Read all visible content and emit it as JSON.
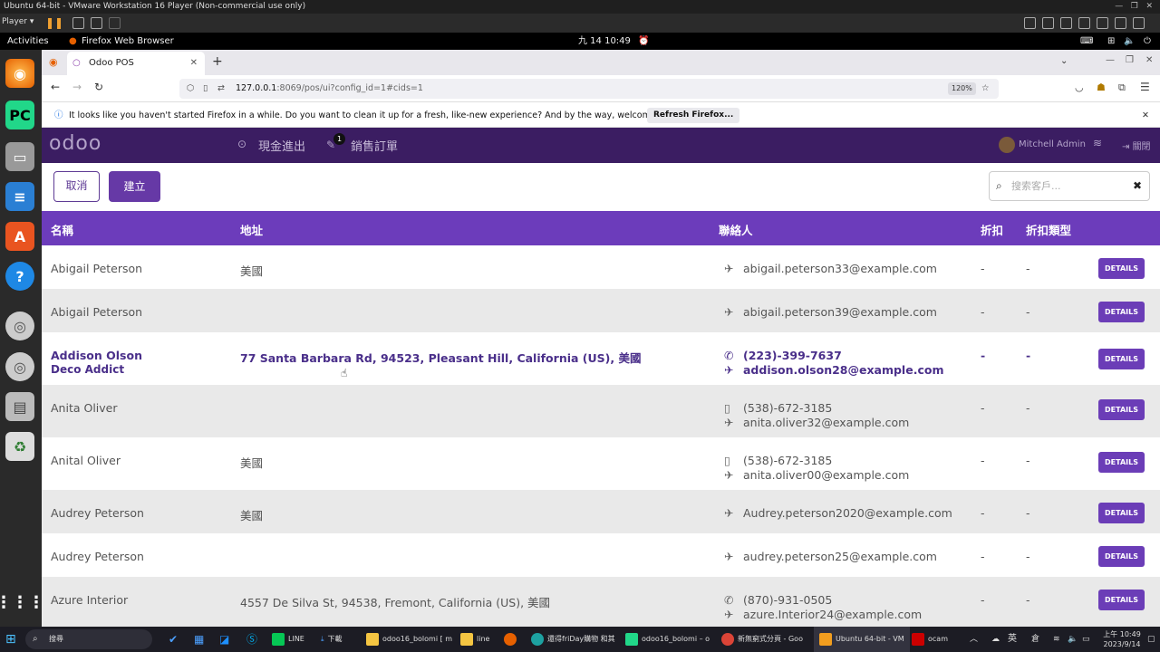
{
  "vmware": {
    "title": "Ubuntu 64-bit - VMware Workstation 16 Player (Non-commercial use only)",
    "player_label": "Player ▾"
  },
  "gnome": {
    "activities": "Activities",
    "app_name": "Firefox Web Browser",
    "clock": "九 14  10:49"
  },
  "browser": {
    "tab_title": "Odoo POS",
    "url_host": "127.0.0.1",
    "url_rest": ":8069/pos/ui?config_id=1#cids=1",
    "zoom": "120%",
    "infobar_text": "It looks like you haven't started Firefox in a while. Do you want to clean it up for a fresh, like-new experience? And by the way, welcome back!",
    "infobar_button": "Refresh Firefox..."
  },
  "odoo": {
    "logo": "odoo",
    "cash_in_out": "現金進出",
    "orders_label": "銷售訂單",
    "orders_badge": "1",
    "user_name": "Mitchell Admin",
    "close_label": "關閉",
    "cancel_button": "取消",
    "create_button": "建立",
    "search_placeholder": "搜索客戶...",
    "columns": {
      "name": "名稱",
      "address": "地址",
      "contact": "聯絡人",
      "discount": "折扣",
      "discount_type": "折扣類型"
    },
    "details_label": "DETAILS",
    "rows": [
      {
        "name": "Abigail Peterson",
        "company": "",
        "address": "美國",
        "phone": "",
        "email": "abigail.peterson33@example.com",
        "discount": "-",
        "discount_type": "-"
      },
      {
        "name": "Abigail Peterson",
        "company": "",
        "address": "",
        "phone": "",
        "email": "abigail.peterson39@example.com",
        "discount": "-",
        "discount_type": "-"
      },
      {
        "name": "Addison Olson",
        "company": "Deco Addict",
        "address": "77 Santa Barbara Rd, 94523, Pleasant Hill, California (US), 美國",
        "phone": "(223)-399-7637",
        "email": "addison.olson28@example.com",
        "discount": "-",
        "discount_type": "-"
      },
      {
        "name": "Anita Oliver",
        "company": "",
        "address": "",
        "phone": "(538)-672-3185",
        "email": "anita.oliver32@example.com",
        "discount": "-",
        "discount_type": "-"
      },
      {
        "name": "Anital Oliver",
        "company": "",
        "address": "美國",
        "phone": "(538)-672-3185",
        "email": "anita.oliver00@example.com",
        "discount": "-",
        "discount_type": "-"
      },
      {
        "name": "Audrey Peterson",
        "company": "",
        "address": "美國",
        "phone": "",
        "email": "Audrey.peterson2020@example.com",
        "discount": "-",
        "discount_type": "-"
      },
      {
        "name": "Audrey Peterson",
        "company": "",
        "address": "",
        "phone": "",
        "email": "audrey.peterson25@example.com",
        "discount": "-",
        "discount_type": "-"
      },
      {
        "name": "Azure Interior",
        "company": "",
        "address": "4557 De Silva St, 94538, Fremont, California (US), 美國",
        "phone": "(870)-931-0505",
        "email": "azure.Interior24@example.com",
        "discount": "-",
        "discount_type": "-"
      }
    ]
  },
  "taskbar": {
    "search": "搜尋",
    "line": "LINE",
    "downloads": "下載",
    "folder1": "odoo16_bolomi [ m",
    "folder2": "line",
    "chrome1": "還得friDay購物 和其",
    "pycharm": "odoo16_bolomi – o",
    "chrome2": "新無窮式分頁 - Goo",
    "vmware": "Ubuntu 64-bit - VM",
    "ocam": "ocam",
    "ime": "英",
    "time": "上午 10:49",
    "date": "2023/9/14"
  }
}
